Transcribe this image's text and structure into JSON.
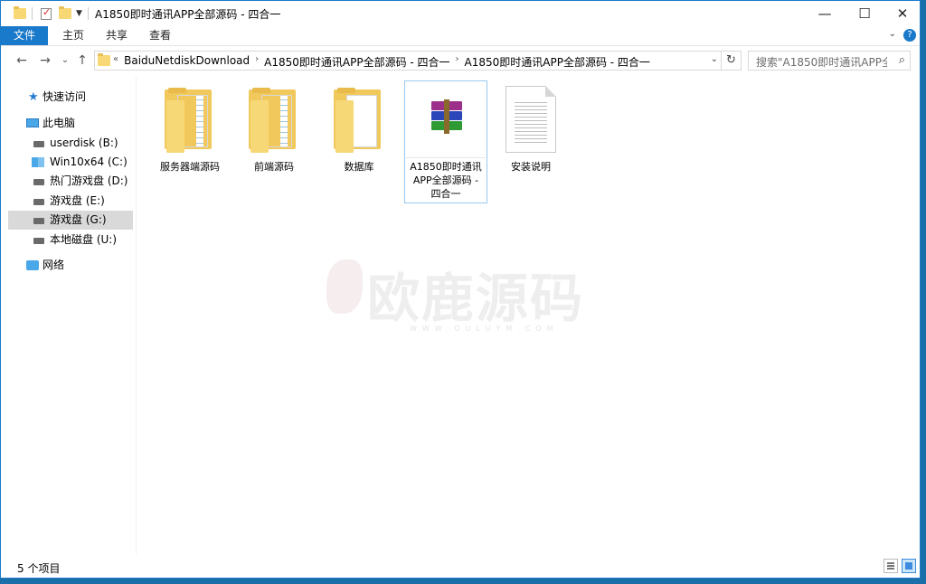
{
  "window": {
    "title": "A1850即时通讯APP全部源码 - 四合一",
    "controls": {
      "minimize": "—",
      "maximize": "☐",
      "close": "✕"
    }
  },
  "ribbon": {
    "tabs": [
      "文件",
      "主页",
      "共享",
      "查看"
    ],
    "help": "?"
  },
  "address": {
    "prefix": "«",
    "crumbs": [
      "BaiduNetdiskDownload",
      "A1850即时通讯APP全部源码 - 四合一",
      "A1850即时通讯APP全部源码 - 四合一"
    ],
    "separator": "›"
  },
  "search": {
    "placeholder": "搜索\"A1850即时通讯APP全..."
  },
  "sidebar": {
    "quick_access": "快速访问",
    "this_pc": "此电脑",
    "drives": [
      {
        "label": "userdisk (B:)",
        "icon": "drive-icon"
      },
      {
        "label": "Win10x64 (C:)",
        "icon": "windows-drive-icon"
      },
      {
        "label": "热门游戏盘 (D:)",
        "icon": "drive-icon"
      },
      {
        "label": "游戏盘 (E:)",
        "icon": "drive-icon"
      },
      {
        "label": "游戏盘 (G:)",
        "icon": "drive-icon"
      },
      {
        "label": "本地磁盘 (U:)",
        "icon": "drive-icon"
      }
    ],
    "network": "网络",
    "selected_index": 4
  },
  "files": [
    {
      "name": "服务器端源码",
      "type": "folder"
    },
    {
      "name": "前端源码",
      "type": "folder"
    },
    {
      "name": "数据库",
      "type": "folder"
    },
    {
      "name": "A1850即时通讯APP全部源码 - 四合一",
      "type": "rar-archive"
    },
    {
      "name": "安装说明",
      "type": "text-document"
    }
  ],
  "watermark": {
    "text": "欧鹿源码",
    "sub": "WWW.OULUYM.COM"
  },
  "status": {
    "item_count": "5 个项目"
  }
}
